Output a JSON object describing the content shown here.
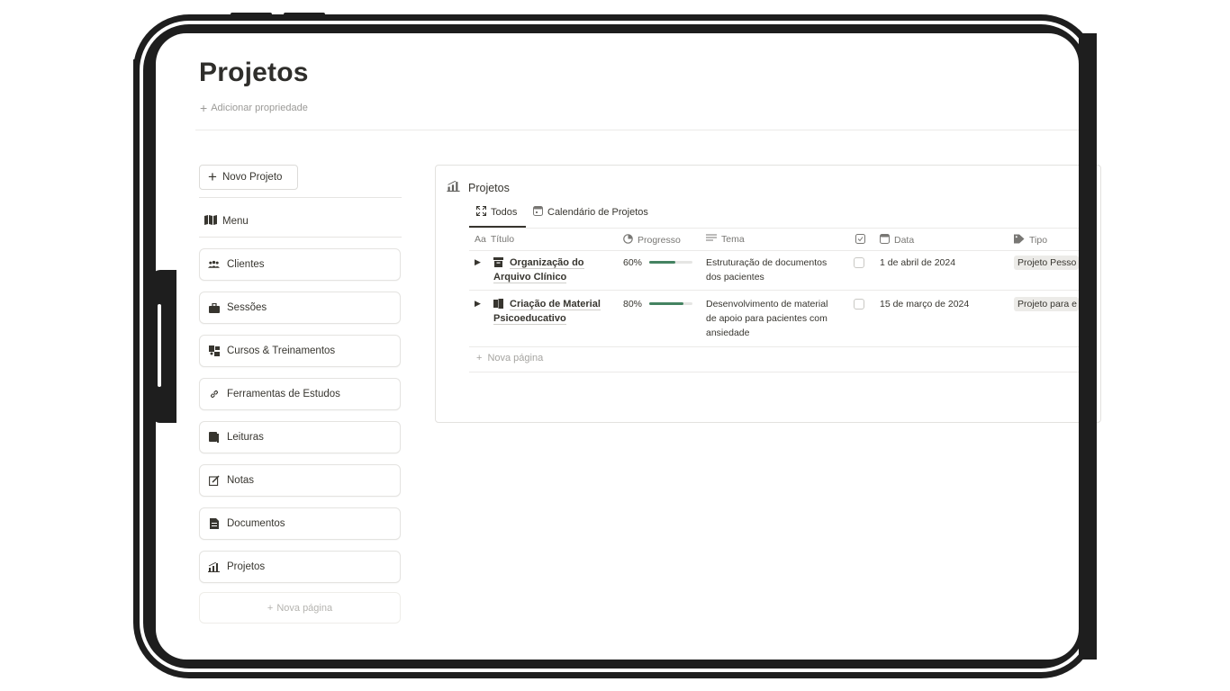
{
  "page": {
    "title": "Projetos",
    "add_property_label": "Adicionar propriedade"
  },
  "sidebar": {
    "new_project_label": "Novo Projeto",
    "menu_label": "Menu",
    "items": [
      {
        "label": "Clientes",
        "icon": "people-icon"
      },
      {
        "label": "Sessões",
        "icon": "briefcase-icon"
      },
      {
        "label": "Cursos & Treinamentos",
        "icon": "presentation-icon"
      },
      {
        "label": "Ferramentas de Estudos",
        "icon": "link-icon"
      },
      {
        "label": "Leituras",
        "icon": "book-icon"
      },
      {
        "label": "Notas",
        "icon": "edit-icon"
      },
      {
        "label": "Documentos",
        "icon": "document-icon"
      },
      {
        "label": "Projetos",
        "icon": "chart-icon"
      }
    ],
    "new_page_label": "Nova página"
  },
  "database": {
    "title": "Projetos",
    "tabs": [
      {
        "label": "Todos",
        "active": true
      },
      {
        "label": "Calendário de Projetos",
        "active": false
      }
    ],
    "columns": {
      "title": "Título",
      "title_prefix": "Aa",
      "progress": "Progresso",
      "theme": "Tema",
      "date": "Data",
      "type": "Tipo"
    },
    "rows": [
      {
        "title_line1": "Organização do",
        "title_line2": "Arquivo Clínico",
        "progress_label": "60%",
        "progress_value": 0.6,
        "theme_line1": "Estruturação de documentos",
        "theme_line2": "dos pacientes",
        "theme_line3": "",
        "checked": false,
        "date": "1 de abril de 2024",
        "type": "Projeto Pesso"
      },
      {
        "title_line1": "Criação de Material",
        "title_line2": "Psicoeducativo",
        "progress_label": "80%",
        "progress_value": 0.8,
        "theme_line1": "Desenvolvimento de material",
        "theme_line2": "de apoio para pacientes com",
        "theme_line3": "ansiedade",
        "checked": false,
        "date": "15 de março de 2024",
        "type": "Projeto para e"
      }
    ],
    "new_page_label": "Nova página"
  },
  "colors": {
    "progress_fill": "#448361",
    "tag_bg": "#ecebe8",
    "frame": "#1e1e1e"
  }
}
